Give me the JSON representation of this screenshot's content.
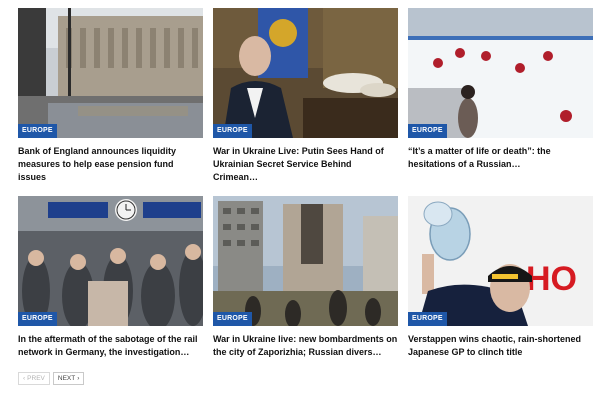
{
  "articles": [
    {
      "category": "EUROPE",
      "title": "Bank of England announces liquidity measures to help ease pension fund issues",
      "image_icon": "bank-of-england-photo"
    },
    {
      "category": "EUROPE",
      "title": "War in Ukraine Live: Putin Sees Hand of Ukrainian Secret Service Behind Crimean…",
      "image_icon": "putin-photo"
    },
    {
      "category": "EUROPE",
      "title": "“It’s a matter of life or death”: the hesitations of a Russian…",
      "image_icon": "ice-hockey-photo"
    },
    {
      "category": "EUROPE",
      "title": "In the aftermath of the sabotage of the rail network in Germany, the investigation…",
      "image_icon": "train-station-photo"
    },
    {
      "category": "EUROPE",
      "title": "War in Ukraine live: new bombardments on the city of Zaporizhia; Russian divers…",
      "image_icon": "zaporizhia-building-photo"
    },
    {
      "category": "EUROPE",
      "title": "Verstappen wins chaotic, rain-shortened Japanese GP to clinch title",
      "image_icon": "verstappen-trophy-photo"
    }
  ],
  "pagination": {
    "prev_label": "PREV",
    "next_label": "NEXT",
    "prev_icon": "chevron-left-icon",
    "next_icon": "chevron-right-icon"
  },
  "colors": {
    "badge": "#1f57a8",
    "text": "#111111"
  }
}
